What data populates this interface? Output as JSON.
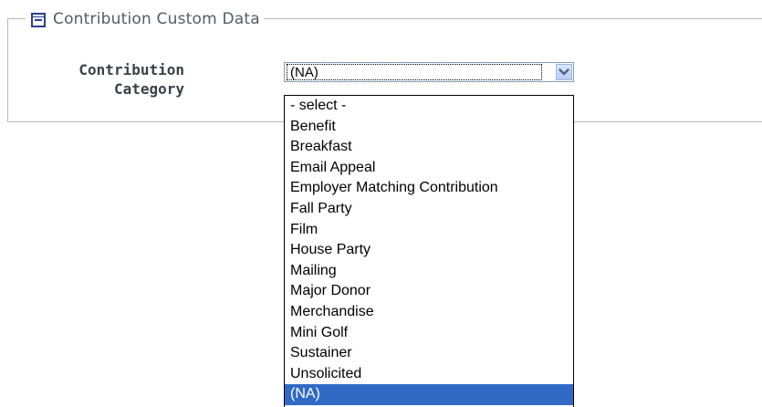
{
  "fieldset": {
    "legend": "Contribution Custom Data"
  },
  "field": {
    "label_line1": "Contribution",
    "label_line2": "Category",
    "selected_value": "(NA)"
  },
  "dropdown": {
    "options": [
      "- select -",
      "Benefit",
      "Breakfast",
      "Email Appeal",
      "Employer Matching Contribution",
      "Fall Party",
      "Film",
      "House Party",
      "Mailing",
      "Major Donor",
      "Merchandise",
      "Mini Golf",
      "Sustainer",
      "Unsolicited",
      "(NA)"
    ],
    "highlighted": "(NA)"
  },
  "icons": {
    "collapse": "collapse-minus-icon",
    "dropdown_arrow": "chevron-down-icon"
  },
  "colors": {
    "highlight": "#316ac5",
    "icon_blue": "#2a3f8f",
    "legend_text": "#555a66",
    "label_text": "#3b3f48",
    "fieldset_border": "#b9b9b9"
  }
}
